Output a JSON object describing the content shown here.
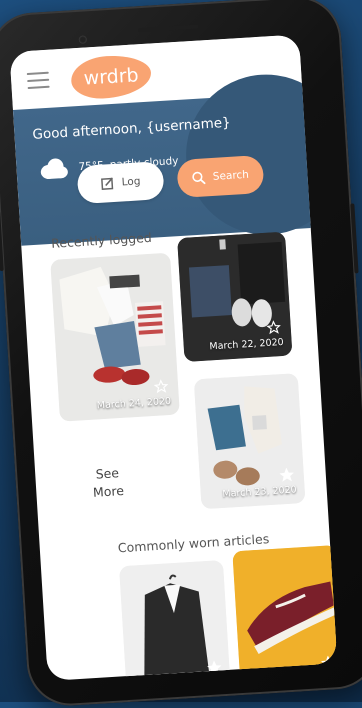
{
  "header": {
    "logo": "wrdrb",
    "menu_icon": "hamburger-icon"
  },
  "hero": {
    "greeting": "Good afternoon, {username}",
    "weather_text": "75°F, partly cloudy",
    "weather_icon": "cloud-icon"
  },
  "actions": {
    "log_label": "Log",
    "search_label": "Search"
  },
  "recent": {
    "title": "Recently logged",
    "items": [
      {
        "date": "March 24, 2020"
      },
      {
        "date": "March 22, 2020"
      },
      {
        "date": "March 23, 2020"
      }
    ],
    "see_more_line1": "See",
    "see_more_line2": "More"
  },
  "common": {
    "title": "Commonly worn articles"
  },
  "colors": {
    "accent": "#f9a472",
    "hero": "#41678a"
  }
}
